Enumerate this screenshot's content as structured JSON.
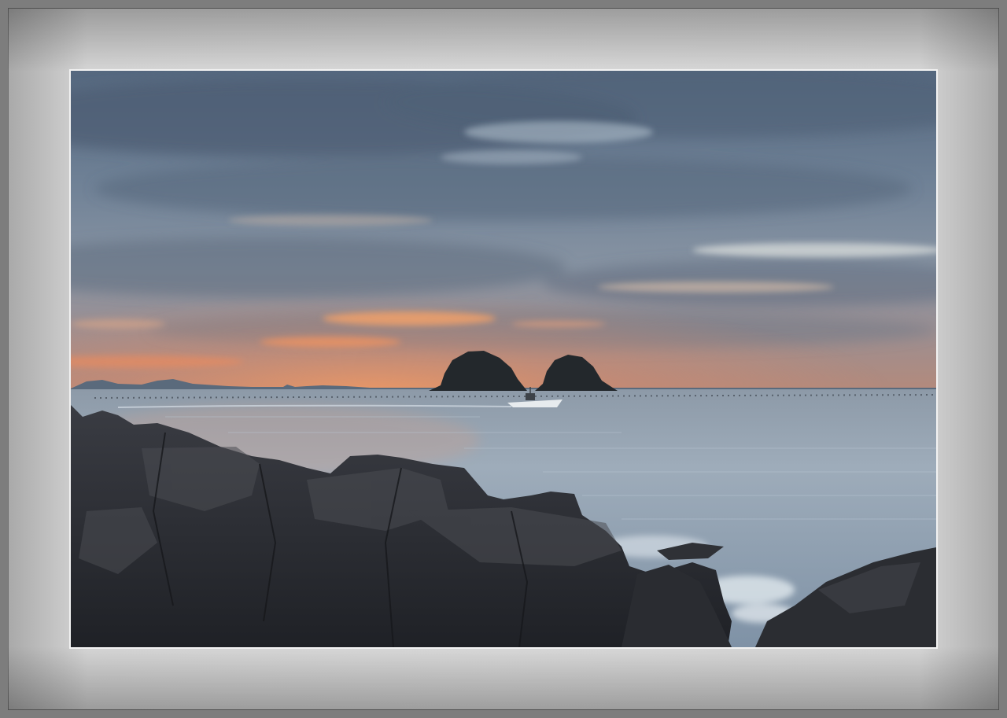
{
  "scene": {
    "subject": "sunset-seascape",
    "colors": {
      "sky_top": "#5d7086",
      "sky_mid": "#7e8ea0",
      "horizon_glow": "#e9875a",
      "sea": "#93a4b6",
      "rock": "#2b2d33",
      "mat": "#d6d6d6",
      "frame": "#7d7d7d"
    }
  }
}
